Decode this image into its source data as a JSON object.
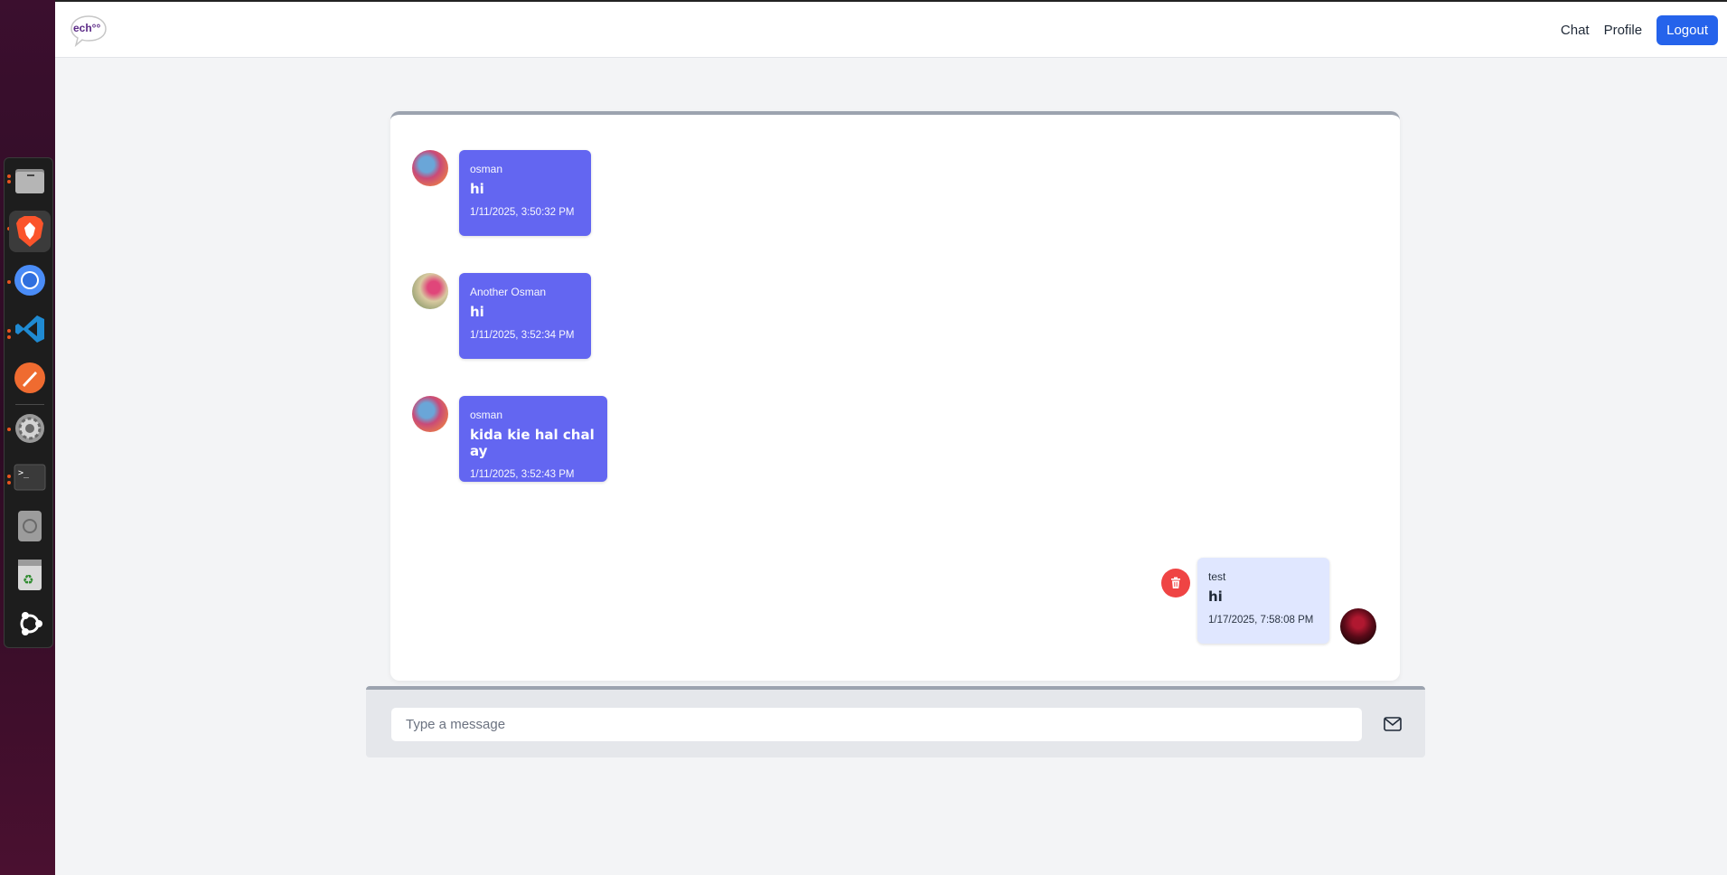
{
  "dock": {
    "items": [
      {
        "name": "files-icon",
        "running": true
      },
      {
        "name": "brave-browser-icon",
        "running": true,
        "active": true
      },
      {
        "name": "chromium-icon",
        "running": true
      },
      {
        "name": "vscode-icon",
        "running": true
      },
      {
        "name": "postman-icon",
        "running": false
      },
      {
        "name": "settings-icon",
        "running": true
      },
      {
        "name": "terminal-icon",
        "running": true
      },
      {
        "name": "disk-icon",
        "running": false
      },
      {
        "name": "trash-icon",
        "running": false
      },
      {
        "name": "ubuntu-apps-icon",
        "running": false
      }
    ]
  },
  "navbar": {
    "logo_text": "ech°°",
    "links": [
      "Chat",
      "Profile"
    ],
    "logout_label": "Logout"
  },
  "colors": {
    "primary": "#2563eb",
    "bubble_other": "#6366f1",
    "bubble_mine": "#e0e7ff",
    "delete": "#ef4444",
    "page_bg": "#f3f4f6"
  },
  "messages": [
    {
      "user": "osman",
      "text": "hi",
      "time": "1/11/2025, 3:50:32 PM",
      "mine": false,
      "avatar": "avatar-osman"
    },
    {
      "user": "Another Osman",
      "text": "hi",
      "time": "1/11/2025, 3:52:34 PM",
      "mine": false,
      "avatar": "avatar-another-osman"
    },
    {
      "user": "osman",
      "text": "kida kie hal chal ay",
      "time": "1/11/2025, 3:52:43 PM",
      "mine": false,
      "avatar": "avatar-osman"
    },
    {
      "user": "test",
      "text": "hi",
      "time": "1/17/2025, 7:58:08 PM",
      "mine": true,
      "avatar": "avatar-test"
    }
  ],
  "composer": {
    "placeholder": "Type a message",
    "value": ""
  }
}
